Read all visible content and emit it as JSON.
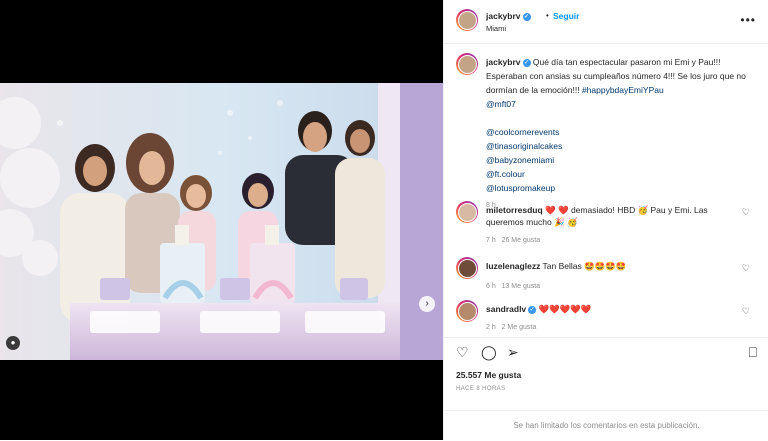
{
  "post": {
    "username": "jackybrv",
    "follow_label": "Seguir",
    "separator": "•",
    "location": "Miami",
    "more_icon": "more-dots-icon"
  },
  "caption": {
    "username": "jackybrv",
    "text": "Qué día tan espectacular pasaron mi Emi y Pau!!! Esperaban con ansias su cumpleaños número 4!!! Se los juro que no dormían de la emoción!!!",
    "hashtag": "#happybdayEmiYPau",
    "mention_main": "@mft07",
    "mentions": [
      "@coolcornerevents",
      "@tinasoriginalcakes",
      "@babyzonemiami",
      "@ft.colour",
      "@lotuspromakeup"
    ],
    "time": "8 h"
  },
  "comments": [
    {
      "username": "miletorresduq",
      "text": "❤️ ❤️ demasiado! HBD 🥳 Pau y Emi. Las queremos mucho 🎉 🥳",
      "time": "7 h",
      "likes": "26 Me gusta"
    },
    {
      "username": "luzelenaglezz",
      "text": "Tan Bellas 🤩🤩🤩🤩",
      "time": "6 h",
      "likes": "13 Me gusta"
    },
    {
      "username": "sandradlv",
      "text": "❤️❤️❤️❤️❤️",
      "time": "2 h",
      "likes": "2 Me gusta"
    }
  ],
  "actions": {
    "likes": "25.557 Me gusta",
    "posted_ago": "HACE 8 HORAS",
    "comments_limited": "Se han limitado los comentarios en esta publicación."
  },
  "colors": {
    "accent": "#0095f6",
    "verified": "#3897f0",
    "carousel_active": "#2b8cff"
  }
}
